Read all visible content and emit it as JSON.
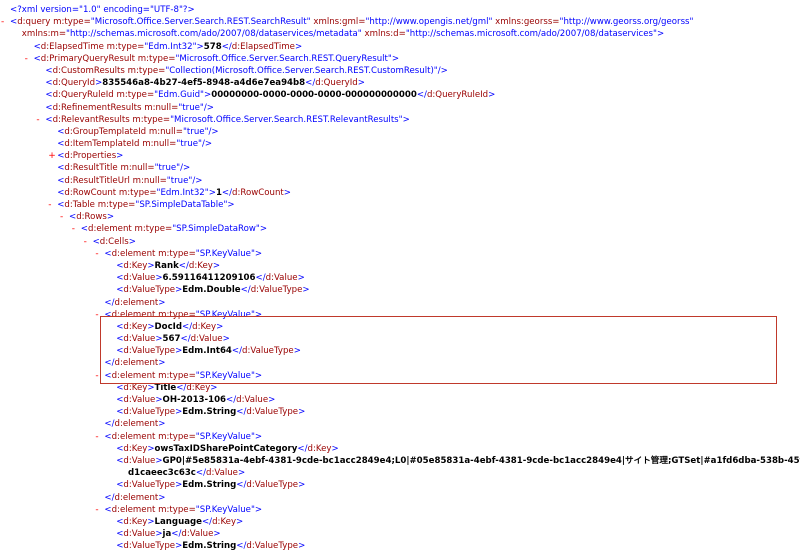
{
  "lines": [
    {
      "toggle": "",
      "level": 0,
      "parts": [
        [
          "p",
          "<?xml version=\"1.0\" encoding=\"UTF-8\"?>"
        ]
      ]
    },
    {
      "toggle": "-",
      "level": 0,
      "parts": [
        [
          "p",
          "<"
        ],
        [
          "t",
          "d:query"
        ],
        [
          "a",
          " m:type="
        ],
        [
          "v",
          "\"Microsoft.Office.Server.Search.REST.SearchResult\""
        ],
        [
          "a",
          " xmlns:gml="
        ],
        [
          "v",
          "\"http://www.opengis.net/gml\""
        ],
        [
          "a",
          " xmlns:georss="
        ],
        [
          "v",
          "\"http://www.georss.org/georss\""
        ]
      ]
    },
    {
      "toggle": "",
      "level": 1,
      "parts": [
        [
          "a",
          "xmlns:m="
        ],
        [
          "v",
          "\"http://schemas.microsoft.com/ado/2007/08/dataservices/metadata\""
        ],
        [
          "a",
          " xmlns:d="
        ],
        [
          "v",
          "\"http://schemas.microsoft.com/ado/2007/08/dataservices\""
        ],
        [
          "p",
          ">"
        ]
      ]
    },
    {
      "toggle": "",
      "level": 2,
      "parts": [
        [
          "p",
          "<"
        ],
        [
          "t",
          "d:ElapsedTime"
        ],
        [
          "a",
          " m:type="
        ],
        [
          "v",
          "\"Edm.Int32\""
        ],
        [
          "p",
          ">"
        ],
        [
          "x",
          "578"
        ],
        [
          "p",
          "</"
        ],
        [
          "t",
          "d:ElapsedTime"
        ],
        [
          "p",
          ">"
        ]
      ]
    },
    {
      "toggle": "-",
      "level": 2,
      "parts": [
        [
          "p",
          "<"
        ],
        [
          "t",
          "d:PrimaryQueryResult"
        ],
        [
          "a",
          " m:type="
        ],
        [
          "v",
          "\"Microsoft.Office.Server.Search.REST.QueryResult\""
        ],
        [
          "p",
          ">"
        ]
      ]
    },
    {
      "toggle": "",
      "level": 3,
      "parts": [
        [
          "p",
          "<"
        ],
        [
          "t",
          "d:CustomResults"
        ],
        [
          "a",
          " m:type="
        ],
        [
          "v",
          "\"Collection(Microsoft.Office.Server.Search.REST.CustomResult)\""
        ],
        [
          "p",
          "/>"
        ]
      ]
    },
    {
      "toggle": "",
      "level": 3,
      "parts": [
        [
          "p",
          "<"
        ],
        [
          "t",
          "d:QueryId"
        ],
        [
          "p",
          ">"
        ],
        [
          "x",
          "835546a8-4b27-4ef5-8948-a4d6e7ea94b8"
        ],
        [
          "p",
          "</"
        ],
        [
          "t",
          "d:QueryId"
        ],
        [
          "p",
          ">"
        ]
      ]
    },
    {
      "toggle": "",
      "level": 3,
      "parts": [
        [
          "p",
          "<"
        ],
        [
          "t",
          "d:QueryRuleId"
        ],
        [
          "a",
          " m:type="
        ],
        [
          "v",
          "\"Edm.Guid\""
        ],
        [
          "p",
          ">"
        ],
        [
          "x",
          "00000000-0000-0000-0000-000000000000"
        ],
        [
          "p",
          "</"
        ],
        [
          "t",
          "d:QueryRuleId"
        ],
        [
          "p",
          ">"
        ]
      ]
    },
    {
      "toggle": "",
      "level": 3,
      "parts": [
        [
          "p",
          "<"
        ],
        [
          "t",
          "d:RefinementResults"
        ],
        [
          "a",
          " m:null="
        ],
        [
          "v",
          "\"true\""
        ],
        [
          "p",
          "/>"
        ]
      ]
    },
    {
      "toggle": "-",
      "level": 3,
      "parts": [
        [
          "p",
          "<"
        ],
        [
          "t",
          "d:RelevantResults"
        ],
        [
          "a",
          " m:type="
        ],
        [
          "v",
          "\"Microsoft.Office.Server.Search.REST.RelevantResults\""
        ],
        [
          "p",
          ">"
        ]
      ]
    },
    {
      "toggle": "",
      "level": 4,
      "parts": [
        [
          "p",
          "<"
        ],
        [
          "t",
          "d:GroupTemplateId"
        ],
        [
          "a",
          " m:null="
        ],
        [
          "v",
          "\"true\""
        ],
        [
          "p",
          "/>"
        ]
      ]
    },
    {
      "toggle": "",
      "level": 4,
      "parts": [
        [
          "p",
          "<"
        ],
        [
          "t",
          "d:ItemTemplateId"
        ],
        [
          "a",
          " m:null="
        ],
        [
          "v",
          "\"true\""
        ],
        [
          "p",
          "/>"
        ]
      ]
    },
    {
      "toggle": "+",
      "level": 4,
      "parts": [
        [
          "p",
          "<"
        ],
        [
          "t",
          "d:Properties"
        ],
        [
          "p",
          ">"
        ]
      ]
    },
    {
      "toggle": "",
      "level": 4,
      "parts": [
        [
          "p",
          "<"
        ],
        [
          "t",
          "d:ResultTitle"
        ],
        [
          "a",
          " m:null="
        ],
        [
          "v",
          "\"true\""
        ],
        [
          "p",
          "/>"
        ]
      ]
    },
    {
      "toggle": "",
      "level": 4,
      "parts": [
        [
          "p",
          "<"
        ],
        [
          "t",
          "d:ResultTitleUrl"
        ],
        [
          "a",
          " m:null="
        ],
        [
          "v",
          "\"true\""
        ],
        [
          "p",
          "/>"
        ]
      ]
    },
    {
      "toggle": "",
      "level": 4,
      "parts": [
        [
          "p",
          "<"
        ],
        [
          "t",
          "d:RowCount"
        ],
        [
          "a",
          " m:type="
        ],
        [
          "v",
          "\"Edm.Int32\""
        ],
        [
          "p",
          ">"
        ],
        [
          "x",
          "1"
        ],
        [
          "p",
          "</"
        ],
        [
          "t",
          "d:RowCount"
        ],
        [
          "p",
          ">"
        ]
      ]
    },
    {
      "toggle": "-",
      "level": 4,
      "parts": [
        [
          "p",
          "<"
        ],
        [
          "t",
          "d:Table"
        ],
        [
          "a",
          " m:type="
        ],
        [
          "v",
          "\"SP.SimpleDataTable\""
        ],
        [
          "p",
          ">"
        ]
      ]
    },
    {
      "toggle": "-",
      "level": 5,
      "parts": [
        [
          "p",
          "<"
        ],
        [
          "t",
          "d:Rows"
        ],
        [
          "p",
          ">"
        ]
      ]
    },
    {
      "toggle": "-",
      "level": 6,
      "parts": [
        [
          "p",
          "<"
        ],
        [
          "t",
          "d:element"
        ],
        [
          "a",
          " m:type="
        ],
        [
          "v",
          "\"SP.SimpleDataRow\""
        ],
        [
          "p",
          ">"
        ]
      ]
    },
    {
      "toggle": "-",
      "level": 7,
      "parts": [
        [
          "p",
          "<"
        ],
        [
          "t",
          "d:Cells"
        ],
        [
          "p",
          ">"
        ]
      ]
    },
    {
      "toggle": "-",
      "level": 8,
      "parts": [
        [
          "p",
          "<"
        ],
        [
          "t",
          "d:element"
        ],
        [
          "a",
          " m:type="
        ],
        [
          "v",
          "\"SP.KeyValue\""
        ],
        [
          "p",
          ">"
        ]
      ]
    },
    {
      "toggle": "",
      "level": 9,
      "parts": [
        [
          "p",
          "<"
        ],
        [
          "t",
          "d:Key"
        ],
        [
          "p",
          ">"
        ],
        [
          "x",
          "Rank"
        ],
        [
          "p",
          "</"
        ],
        [
          "t",
          "d:Key"
        ],
        [
          "p",
          ">"
        ]
      ]
    },
    {
      "toggle": "",
      "level": 9,
      "parts": [
        [
          "p",
          "<"
        ],
        [
          "t",
          "d:Value"
        ],
        [
          "p",
          ">"
        ],
        [
          "x",
          "6.59116411209106"
        ],
        [
          "p",
          "</"
        ],
        [
          "t",
          "d:Value"
        ],
        [
          "p",
          ">"
        ]
      ]
    },
    {
      "toggle": "",
      "level": 9,
      "parts": [
        [
          "p",
          "<"
        ],
        [
          "t",
          "d:ValueType"
        ],
        [
          "p",
          ">"
        ],
        [
          "x",
          "Edm.Double"
        ],
        [
          "p",
          "</"
        ],
        [
          "t",
          "d:ValueType"
        ],
        [
          "p",
          ">"
        ]
      ]
    },
    {
      "toggle": "",
      "level": 8,
      "parts": [
        [
          "p",
          "</"
        ],
        [
          "t",
          "d:element"
        ],
        [
          "p",
          ">"
        ]
      ]
    },
    {
      "toggle": "-",
      "level": 8,
      "parts": [
        [
          "p",
          "<"
        ],
        [
          "t",
          "d:element"
        ],
        [
          "a",
          " m:type="
        ],
        [
          "v",
          "\"SP.KeyValue\""
        ],
        [
          "p",
          ">"
        ]
      ]
    },
    {
      "toggle": "",
      "level": 9,
      "parts": [
        [
          "p",
          "<"
        ],
        [
          "t",
          "d:Key"
        ],
        [
          "p",
          ">"
        ],
        [
          "x",
          "DocId"
        ],
        [
          "p",
          "</"
        ],
        [
          "t",
          "d:Key"
        ],
        [
          "p",
          ">"
        ]
      ]
    },
    {
      "toggle": "",
      "level": 9,
      "parts": [
        [
          "p",
          "<"
        ],
        [
          "t",
          "d:Value"
        ],
        [
          "p",
          ">"
        ],
        [
          "x",
          "567"
        ],
        [
          "p",
          "</"
        ],
        [
          "t",
          "d:Value"
        ],
        [
          "p",
          ">"
        ]
      ]
    },
    {
      "toggle": "",
      "level": 9,
      "parts": [
        [
          "p",
          "<"
        ],
        [
          "t",
          "d:ValueType"
        ],
        [
          "p",
          ">"
        ],
        [
          "x",
          "Edm.Int64"
        ],
        [
          "p",
          "</"
        ],
        [
          "t",
          "d:ValueType"
        ],
        [
          "p",
          ">"
        ]
      ]
    },
    {
      "toggle": "",
      "level": 8,
      "parts": [
        [
          "p",
          "</"
        ],
        [
          "t",
          "d:element"
        ],
        [
          "p",
          ">"
        ]
      ]
    },
    {
      "toggle": "-",
      "level": 8,
      "parts": [
        [
          "p",
          "<"
        ],
        [
          "t",
          "d:element"
        ],
        [
          "a",
          " m:type="
        ],
        [
          "v",
          "\"SP.KeyValue\""
        ],
        [
          "p",
          ">"
        ]
      ]
    },
    {
      "toggle": "",
      "level": 9,
      "parts": [
        [
          "p",
          "<"
        ],
        [
          "t",
          "d:Key"
        ],
        [
          "p",
          ">"
        ],
        [
          "x",
          "Title"
        ],
        [
          "p",
          "</"
        ],
        [
          "t",
          "d:Key"
        ],
        [
          "p",
          ">"
        ]
      ]
    },
    {
      "toggle": "",
      "level": 9,
      "parts": [
        [
          "p",
          "<"
        ],
        [
          "t",
          "d:Value"
        ],
        [
          "p",
          ">"
        ],
        [
          "x",
          "OH-2013-106"
        ],
        [
          "p",
          "</"
        ],
        [
          "t",
          "d:Value"
        ],
        [
          "p",
          ">"
        ]
      ]
    },
    {
      "toggle": "",
      "level": 9,
      "parts": [
        [
          "p",
          "<"
        ],
        [
          "t",
          "d:ValueType"
        ],
        [
          "p",
          ">"
        ],
        [
          "x",
          "Edm.String"
        ],
        [
          "p",
          "</"
        ],
        [
          "t",
          "d:ValueType"
        ],
        [
          "p",
          ">"
        ]
      ]
    },
    {
      "toggle": "",
      "level": 8,
      "parts": [
        [
          "p",
          "</"
        ],
        [
          "t",
          "d:element"
        ],
        [
          "p",
          ">"
        ]
      ]
    },
    {
      "toggle": "-",
      "level": 8,
      "parts": [
        [
          "p",
          "<"
        ],
        [
          "t",
          "d:element"
        ],
        [
          "a",
          " m:type="
        ],
        [
          "v",
          "\"SP.KeyValue\""
        ],
        [
          "p",
          ">"
        ]
      ]
    },
    {
      "toggle": "",
      "level": 9,
      "parts": [
        [
          "p",
          "<"
        ],
        [
          "t",
          "d:Key"
        ],
        [
          "p",
          ">"
        ],
        [
          "x",
          "owsTaxIDSharePointCategory"
        ],
        [
          "p",
          "</"
        ],
        [
          "t",
          "d:Key"
        ],
        [
          "p",
          ">"
        ]
      ]
    },
    {
      "toggle": "",
      "level": 9,
      "parts": [
        [
          "p",
          "<"
        ],
        [
          "t",
          "d:Value"
        ],
        [
          "p",
          ">"
        ],
        [
          "x",
          "GP0|#5e85831a-4ebf-4381-9cde-bc1acc2849e4;L0|#05e85831a-4ebf-4381-9cde-bc1acc2849e4|サイト管理;GTSet|#a1fd6dba-538b-45f7-a997-"
        ]
      ]
    },
    {
      "toggle": "",
      "level": 10,
      "parts": [
        [
          "x",
          "d1caeec3c63c"
        ],
        [
          "p",
          "</"
        ],
        [
          "t",
          "d:Value"
        ],
        [
          "p",
          ">"
        ]
      ]
    },
    {
      "toggle": "",
      "level": 9,
      "parts": [
        [
          "p",
          "<"
        ],
        [
          "t",
          "d:ValueType"
        ],
        [
          "p",
          ">"
        ],
        [
          "x",
          "Edm.String"
        ],
        [
          "p",
          "</"
        ],
        [
          "t",
          "d:ValueType"
        ],
        [
          "p",
          ">"
        ]
      ]
    },
    {
      "toggle": "",
      "level": 8,
      "parts": [
        [
          "p",
          "</"
        ],
        [
          "t",
          "d:element"
        ],
        [
          "p",
          ">"
        ]
      ]
    },
    {
      "toggle": "-",
      "level": 8,
      "parts": [
        [
          "p",
          "<"
        ],
        [
          "t",
          "d:element"
        ],
        [
          "a",
          " m:type="
        ],
        [
          "v",
          "\"SP.KeyValue\""
        ],
        [
          "p",
          ">"
        ]
      ]
    },
    {
      "toggle": "",
      "level": 9,
      "parts": [
        [
          "p",
          "<"
        ],
        [
          "t",
          "d:Key"
        ],
        [
          "p",
          ">"
        ],
        [
          "x",
          "Language"
        ],
        [
          "p",
          "</"
        ],
        [
          "t",
          "d:Key"
        ],
        [
          "p",
          ">"
        ]
      ]
    },
    {
      "toggle": "",
      "level": 9,
      "parts": [
        [
          "p",
          "<"
        ],
        [
          "t",
          "d:Value"
        ],
        [
          "p",
          ">"
        ],
        [
          "x",
          "ja"
        ],
        [
          "p",
          "</"
        ],
        [
          "t",
          "d:Value"
        ],
        [
          "p",
          ">"
        ]
      ]
    },
    {
      "toggle": "",
      "level": 9,
      "parts": [
        [
          "p",
          "<"
        ],
        [
          "t",
          "d:ValueType"
        ],
        [
          "p",
          ">"
        ],
        [
          "x",
          "Edm.String"
        ],
        [
          "p",
          "</"
        ],
        [
          "t",
          "d:ValueType"
        ],
        [
          "p",
          ">"
        ]
      ]
    }
  ],
  "colors": {
    "tag": "#990000",
    "attribute_value": "#0000ff",
    "punctuation": "#0000ff",
    "text": "#000000",
    "toggle": "#ff0000",
    "highlight_border": "#c0392b"
  }
}
